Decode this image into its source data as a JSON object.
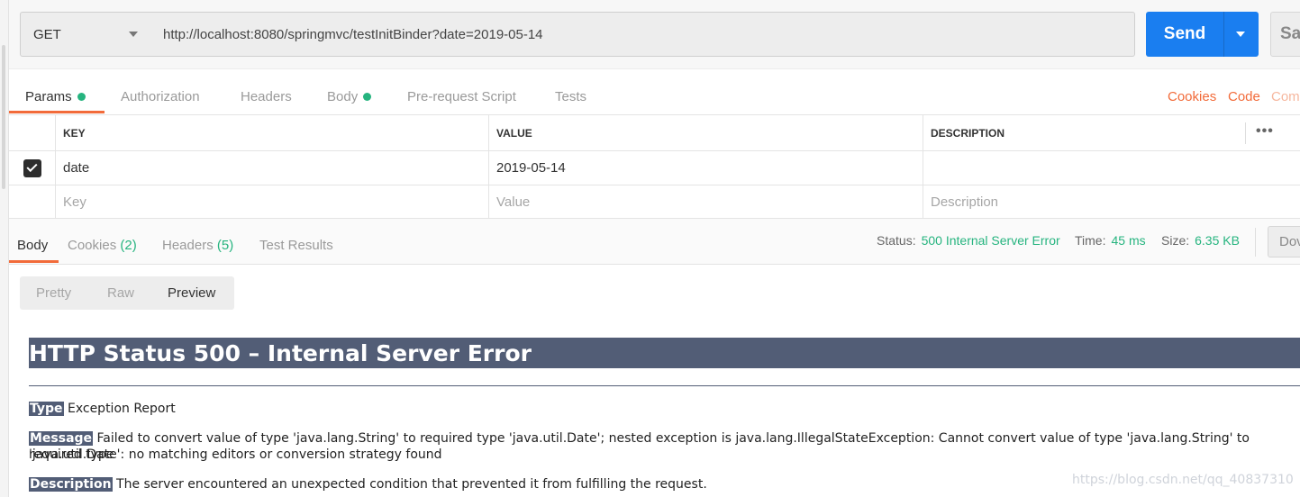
{
  "request": {
    "method": "GET",
    "url": "http://localhost:8080/springmvc/testInitBinder?date=2019-05-14",
    "send_label": "Send",
    "save_label": "Sav"
  },
  "request_tabs": {
    "items": [
      {
        "label": "Params",
        "dot": true
      },
      {
        "label": "Authorization",
        "dot": false
      },
      {
        "label": "Headers",
        "dot": false
      },
      {
        "label": "Body",
        "dot": true
      },
      {
        "label": "Pre-request Script",
        "dot": false
      },
      {
        "label": "Tests",
        "dot": false
      }
    ],
    "active": "Params",
    "right_links": [
      "Cookies",
      "Code",
      "Com"
    ]
  },
  "params_table": {
    "headers": {
      "key": "KEY",
      "value": "VALUE",
      "description": "DESCRIPTION"
    },
    "more_label": "•••",
    "rows": [
      {
        "checked": true,
        "key": "date",
        "value": "2019-05-14",
        "description": ""
      }
    ],
    "placeholders": {
      "key": "Key",
      "value": "Value",
      "description": "Description"
    }
  },
  "response": {
    "tabs": [
      {
        "label": "Body",
        "count": ""
      },
      {
        "label": "Cookies",
        "count": "(2)"
      },
      {
        "label": "Headers",
        "count": "(5)"
      },
      {
        "label": "Test Results",
        "count": ""
      }
    ],
    "active": "Body",
    "status_label": "Status:",
    "status_value": "500 Internal Server Error",
    "time_label": "Time:",
    "time_value": "45 ms",
    "size_label": "Size:",
    "size_value": "6.35 KB",
    "download_label": "Dov"
  },
  "view_toggle": {
    "options": [
      "Pretty",
      "Raw",
      "Preview"
    ],
    "active": "Preview"
  },
  "preview": {
    "title": "HTTP Status 500 – Internal Server Error",
    "type_label": "Type",
    "type_text": "Exception Report",
    "message_label": "Message",
    "message_text": "Failed to convert value of type 'java.lang.String' to required type 'java.util.Date'; nested exception is java.lang.IllegalStateException: Cannot convert value of type 'java.lang.String' to required type",
    "message_text_2": "'java.util.Date': no matching editors or conversion strategy found",
    "description_label": "Description",
    "description_text": "The server encountered an unexpected condition that prevented it from fulfilling the request."
  },
  "watermark": "https://blog.csdn.net/qq_40837310",
  "colors": {
    "accent": "#f26b3a",
    "send_blue": "#1a7ef0",
    "status_green": "#26b47f",
    "tomcat_header": "#525d76"
  }
}
